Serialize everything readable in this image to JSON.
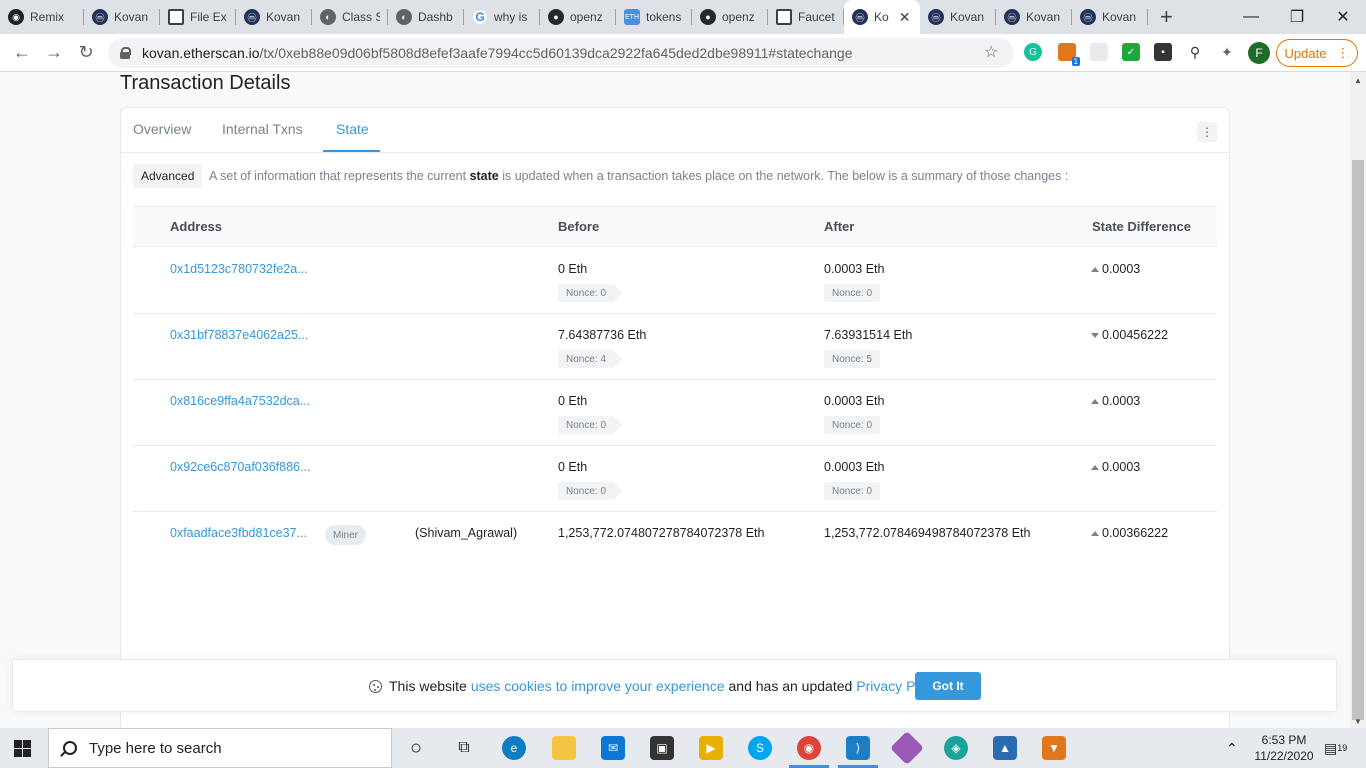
{
  "browser": {
    "tabs": [
      {
        "label": "Remix",
        "icon": "remix-icon"
      },
      {
        "label": "Kovan",
        "icon": "etherscan-icon"
      },
      {
        "label": "File Ex",
        "icon": "file-icon"
      },
      {
        "label": "Kovan",
        "icon": "etherscan-icon"
      },
      {
        "label": "Class S",
        "icon": "globe-icon"
      },
      {
        "label": "Dashb",
        "icon": "globe-icon"
      },
      {
        "label": "why is",
        "icon": "google-icon"
      },
      {
        "label": "openz",
        "icon": "github-icon"
      },
      {
        "label": "tokens",
        "icon": "eth-icon"
      },
      {
        "label": "openz",
        "icon": "github-icon"
      },
      {
        "label": "Faucet",
        "icon": "book-icon"
      },
      {
        "label": "Ko",
        "icon": "etherscan-icon",
        "active": true
      },
      {
        "label": "Kovan",
        "icon": "etherscan-icon"
      },
      {
        "label": "Kovan",
        "icon": "etherscan-icon"
      },
      {
        "label": "Kovan",
        "icon": "etherscan-icon"
      }
    ],
    "url_host": "kovan.etherscan.io",
    "url_path": "/tx/0xeb88e09d06bf5808d8efef3aafe7994cc5d60139dca2922fa645ded2dbe98911#statechange",
    "profile_initial": "F",
    "update_label": "Update",
    "metamask_badge": "1"
  },
  "page": {
    "title": "Transaction Details",
    "tabs": [
      "Overview",
      "Internal Txns",
      "State"
    ],
    "active_tab": "State",
    "advanced_label": "Advanced",
    "description_pre": "A set of information that represents the current ",
    "description_bold": "state",
    "description_post": " is updated when a transaction takes place on the network. The below is a summary of those changes :",
    "columns": [
      "Address",
      "Before",
      "After",
      "State Difference"
    ],
    "rows": [
      {
        "address": "0x1d5123c780732fe2a...",
        "before": "0 Eth",
        "before_nonce": "Nonce: 0",
        "after": "0.0003 Eth",
        "after_nonce": "Nonce: 0",
        "diff": "0.0003",
        "direction": "up"
      },
      {
        "address": "0x31bf78837e4062a25...",
        "before": "7.64387736 Eth",
        "before_nonce": "Nonce: 4",
        "after": "7.63931514 Eth",
        "after_nonce": "Nonce: 5",
        "diff": "0.00456222",
        "direction": "down"
      },
      {
        "address": "0x816ce9ffa4a7532dca...",
        "before": "0 Eth",
        "before_nonce": "Nonce: 0",
        "after": "0.0003 Eth",
        "after_nonce": "Nonce: 0",
        "diff": "0.0003",
        "direction": "up"
      },
      {
        "address": "0x92ce6c870af036f886...",
        "before": "0 Eth",
        "before_nonce": "Nonce: 0",
        "after": "0.0003 Eth",
        "after_nonce": "Nonce: 0",
        "diff": "0.0003",
        "direction": "up"
      }
    ],
    "miner_row": {
      "address": "0xfaadface3fbd81ce37...",
      "badge": "Miner",
      "name": "(Shivam_Agrawal)",
      "before": "1,253,772.074807278784072378 Eth",
      "after": "1,253,772.078469498784072378 Eth",
      "diff": "0.00366222",
      "direction": "up"
    }
  },
  "cookie_banner": {
    "text_pre": "This website",
    "link1": "uses cookies to improve your experience",
    "text_mid": "and has an updated",
    "link2": "Privacy Policy.",
    "button": "Got It"
  },
  "taskbar": {
    "search_placeholder": "Type here to search",
    "time": "6:53 PM",
    "date": "11/22/2020",
    "notifications": "19"
  },
  "colors": {
    "accent": "#3498db",
    "muted": "#77838f",
    "update": "#e37400"
  }
}
